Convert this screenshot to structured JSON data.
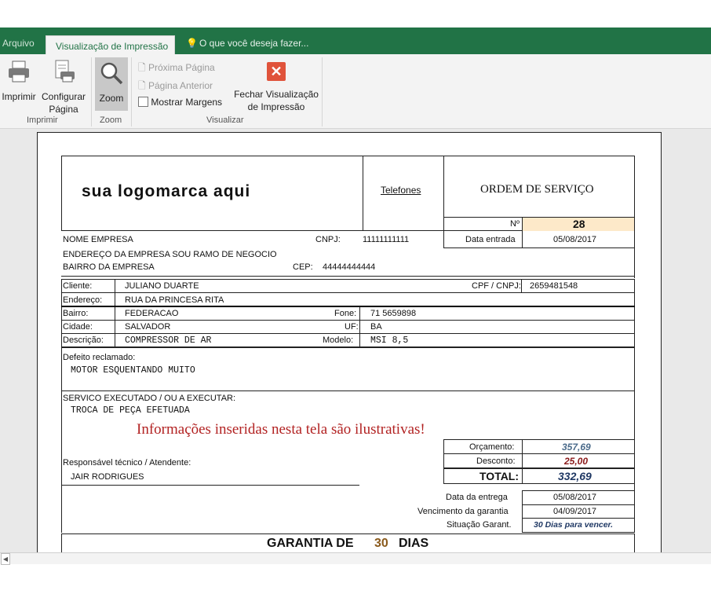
{
  "ribbon": {
    "tabs": {
      "file": "Arquivo",
      "active": "Visualização de Impressão",
      "tell_me": "O que você deseja fazer..."
    },
    "imprimir": "Imprimir",
    "configurar_1": "Configurar",
    "configurar_2": "Página",
    "zoom": "Zoom",
    "proxima": "Próxima Página",
    "anterior": "Página Anterior",
    "mostrar_margens": "Mostrar Margens",
    "fechar_1": "Fechar Visualização",
    "fechar_2": "de Impressão",
    "group_imprimir": "Imprimir",
    "group_zoom": "Zoom",
    "group_visualizar": "Visualizar"
  },
  "form": {
    "logo": "sua logomarca aqui",
    "telefones": "Telefones",
    "title": "ORDEM DE SERVIÇO",
    "num_label": "Nº",
    "num_value": "28",
    "nome_empresa": "NOME EMPRESA",
    "cnpj_label": "CNPJ:",
    "cnpj_value": "11111111111",
    "data_entrada_label": "Data entrada",
    "data_entrada_value": "05/08/2017",
    "endereco_empresa": "ENDEREÇO DA EMPRESA SOU RAMO DE NEGOCIO",
    "bairro_empresa": "BAIRRO DA EMPRESA",
    "cep_label": "CEP:",
    "cep_value": "44444444444",
    "cliente_label": "Cliente:",
    "cliente_value": "JULIANO DUARTE",
    "cpf_label": "CPF / CNPJ:",
    "cpf_value": "2659481548",
    "endereco_label": "Endereço:",
    "endereco_value": "RUA DA PRINCESA RITA",
    "bairro_label": "Bairro:",
    "bairro_value": "FEDERACAO",
    "fone_label": "Fone:",
    "fone_value": "71 5659898",
    "cidade_label": "Cidade:",
    "cidade_value": "SALVADOR",
    "uf_label": "UF:",
    "uf_value": "BA",
    "descricao_label": "Descrição:",
    "descricao_value": "COMPRESSOR DE AR",
    "modelo_label": "Modelo:",
    "modelo_value": "MSI 8,5",
    "defeito_label": "Defeito reclamado:",
    "defeito_value": "MOTOR ESQUENTANDO MUITO",
    "servico_label": "SERVICO EXECUTADO / OU A EXECUTAR:",
    "servico_value": "TROCA DE PEÇA EFETUADA",
    "notice": "Informações inseridas nesta tela são ilustrativas!",
    "orcamento_label": "Orçamento:",
    "orcamento_value": "357,69",
    "desconto_label": "Desconto:",
    "desconto_value": "25,00",
    "total_label": "TOTAL:",
    "total_value": "332,69",
    "responsavel_label": "Responsável técnico / Atendente:",
    "responsavel_value": "JAIR RODRIGUES",
    "data_entrega_label": "Data da entrega",
    "data_entrega_value": "05/08/2017",
    "vencimento_label": "Vencimento da garantia",
    "vencimento_value": "04/09/2017",
    "situacao_label": "Situação Garant.",
    "situacao_value": "30 Dias para vencer.",
    "garantia_prefix": "GARANTIA DE",
    "garantia_days": "30",
    "garantia_suffix": "DIAS"
  },
  "colors": {
    "excel_green": "#217346",
    "notice_red": "#b22222",
    "value_blue": "#1f3864",
    "discount_red": "#8b1a1a",
    "number_fill": "#fde9c9",
    "days_brown": "#8a5a1c"
  }
}
